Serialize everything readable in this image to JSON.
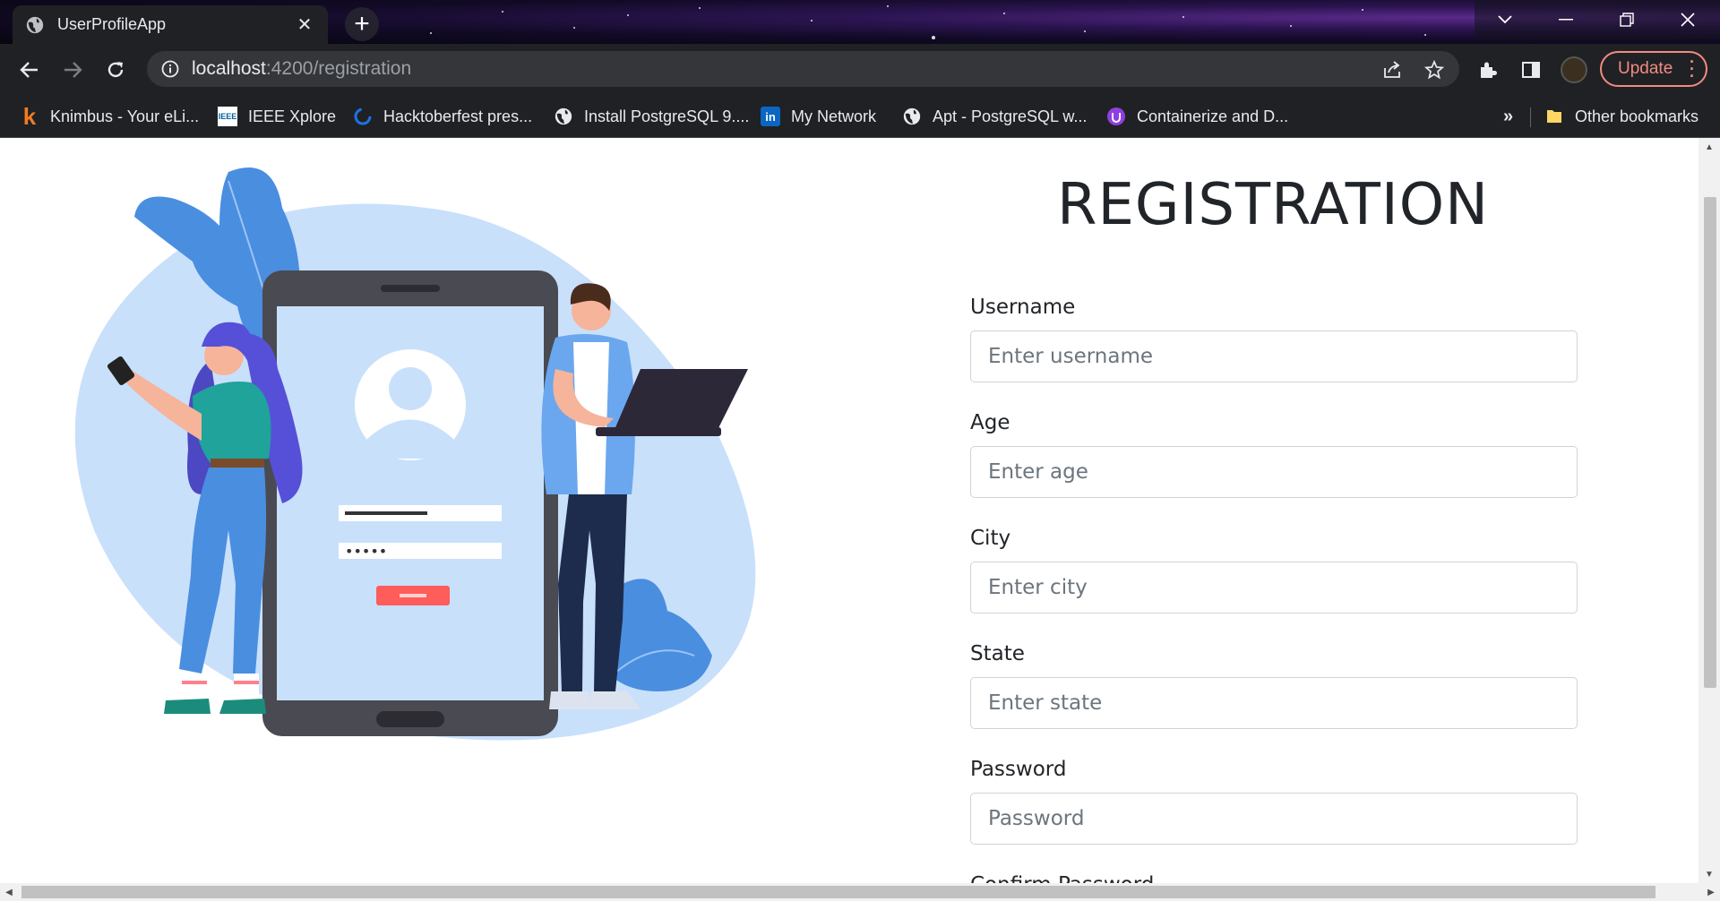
{
  "browser": {
    "tab_title": "UserProfileApp",
    "url_host": "localhost",
    "url_path": ":4200/registration",
    "update_label": "Update",
    "bookmarks": [
      {
        "label": "Knimbus - Your eLi...",
        "icon": "knimbus-icon"
      },
      {
        "label": "IEEE Xplore",
        "icon": "ieee-icon"
      },
      {
        "label": "Hacktoberfest pres...",
        "icon": "hacktoberfest-icon"
      },
      {
        "label": "Install PostgreSQL 9....",
        "icon": "globe-icon"
      },
      {
        "label": "My Network",
        "icon": "linkedin-icon"
      },
      {
        "label": "Apt - PostgreSQL w...",
        "icon": "globe-icon"
      },
      {
        "label": "Containerize and D...",
        "icon": "containerize-icon"
      }
    ],
    "overflow_label": "»",
    "other_bookmarks": "Other bookmarks"
  },
  "page": {
    "title": "REGISTRATION",
    "fields": {
      "username": {
        "label": "Username",
        "placeholder": "Enter username"
      },
      "age": {
        "label": "Age",
        "placeholder": "Enter age"
      },
      "city": {
        "label": "City",
        "placeholder": "Enter city"
      },
      "state": {
        "label": "State",
        "placeholder": "Enter state"
      },
      "password": {
        "label": "Password",
        "placeholder": "Password"
      },
      "confirm_password": {
        "label": "Confirm Password"
      }
    },
    "illustration": {
      "password_mask": "•••••"
    }
  },
  "colors": {
    "tab_bg": "#202124",
    "accent_update": "#f28b82",
    "illustration_blob": "#c9e0fb",
    "illustration_button": "#ff5c5c"
  }
}
